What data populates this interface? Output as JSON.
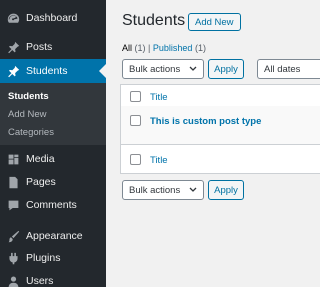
{
  "sidebar": {
    "items": [
      {
        "label": "Dashboard",
        "icon": "dashboard-icon"
      },
      {
        "label": "Posts",
        "icon": "pin-icon"
      },
      {
        "label": "Students",
        "icon": "pin-icon",
        "active": true
      },
      {
        "label": "Media",
        "icon": "media-icon"
      },
      {
        "label": "Pages",
        "icon": "page-icon"
      },
      {
        "label": "Comments",
        "icon": "comment-icon"
      },
      {
        "label": "Appearance",
        "icon": "brush-icon"
      },
      {
        "label": "Plugins",
        "icon": "plug-icon"
      },
      {
        "label": "Users",
        "icon": "user-icon"
      }
    ],
    "submenu": [
      "Students",
      "Add New",
      "Categories"
    ]
  },
  "page": {
    "title": "Students",
    "add_new_label": "Add New"
  },
  "filters": {
    "all_label": "All",
    "all_count": "(1)",
    "separator": "|",
    "published_label": "Published",
    "published_count": "(1)"
  },
  "actions_top": {
    "bulk_actions": "Bulk actions",
    "apply": "Apply",
    "dates": "All dates"
  },
  "table": {
    "header_title": "Title",
    "rows": [
      {
        "title": "This is custom post type"
      }
    ],
    "footer_title": "Title"
  },
  "actions_bottom": {
    "bulk_actions": "Bulk actions",
    "apply": "Apply"
  },
  "colors": {
    "sidebar_bg": "#23282d",
    "active_bg": "#0073aa",
    "link": "#0073aa"
  }
}
